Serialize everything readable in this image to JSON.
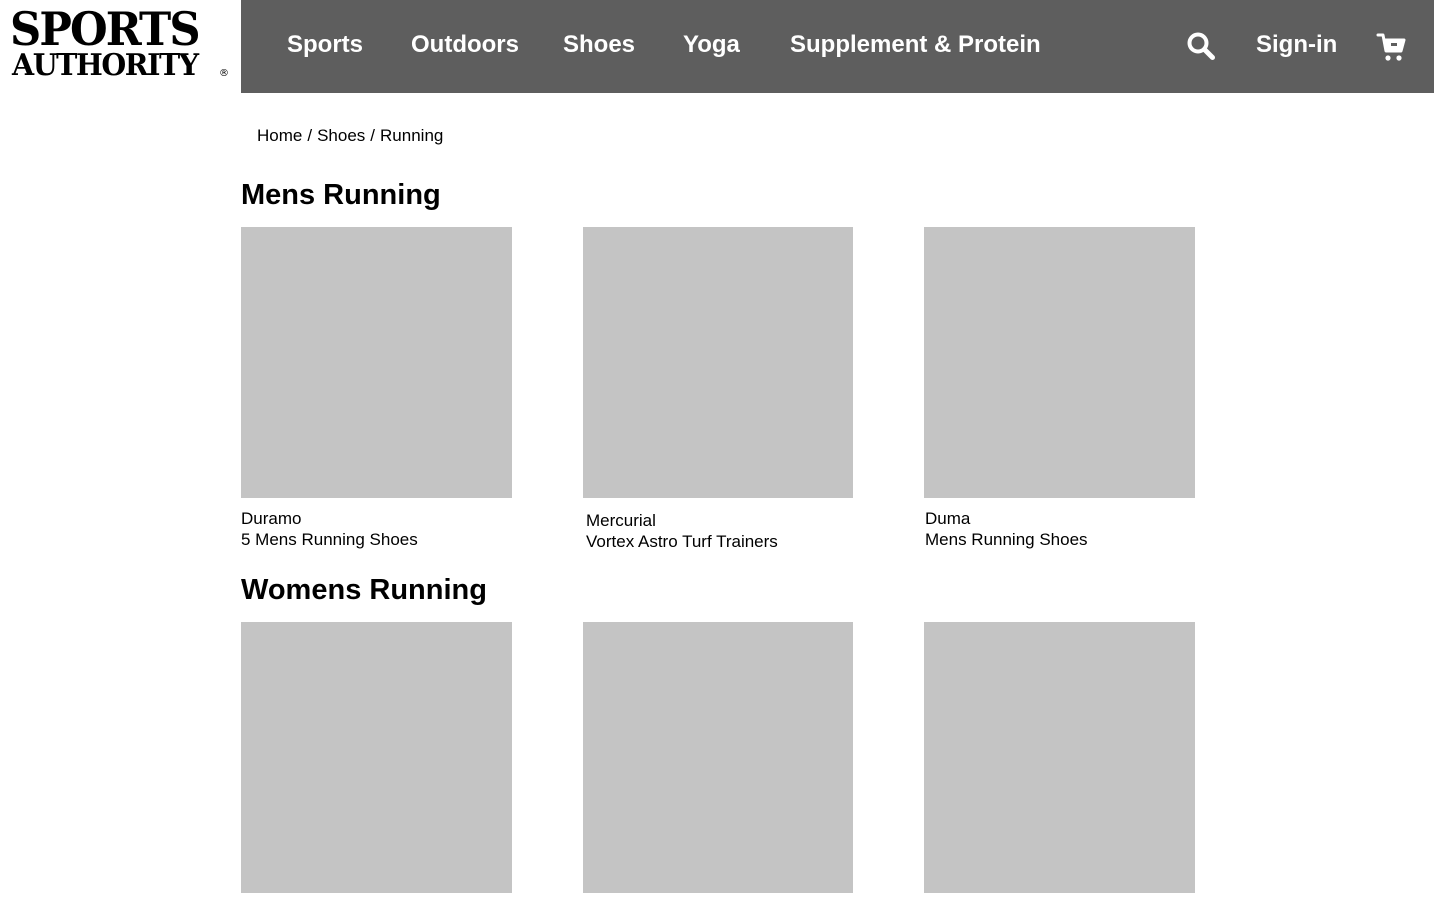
{
  "brand": {
    "line1": "SPORTS",
    "line2": "AUTHORITY",
    "registered": "®"
  },
  "nav": {
    "items": [
      {
        "label": "Sports"
      },
      {
        "label": "Outdoors"
      },
      {
        "label": "Shoes"
      },
      {
        "label": "Yoga"
      },
      {
        "label": "Supplement & Protein"
      }
    ],
    "search_icon": "search-icon",
    "sign_in_label": "Sign-in",
    "cart_icon": "cart-icon",
    "header_color": "#5e5e5e"
  },
  "breadcrumb": {
    "items": [
      "Home",
      "Shoes",
      "Running"
    ],
    "separator": "/"
  },
  "sections": [
    {
      "title": "Mens Running",
      "products": [
        {
          "line1": "Duramo",
          "line2": "5 Mens Running Shoes"
        },
        {
          "line1": "Mercurial",
          "line2": "Vortex Astro Turf Trainers"
        },
        {
          "line1": "Duma",
          "line2": "Mens Running Shoes"
        }
      ]
    },
    {
      "title": "Womens Running",
      "products": [
        {
          "line1": "",
          "line2": ""
        },
        {
          "line1": "",
          "line2": ""
        },
        {
          "line1": "",
          "line2": ""
        }
      ]
    }
  ],
  "placeholder_color": "#c4c4c4"
}
